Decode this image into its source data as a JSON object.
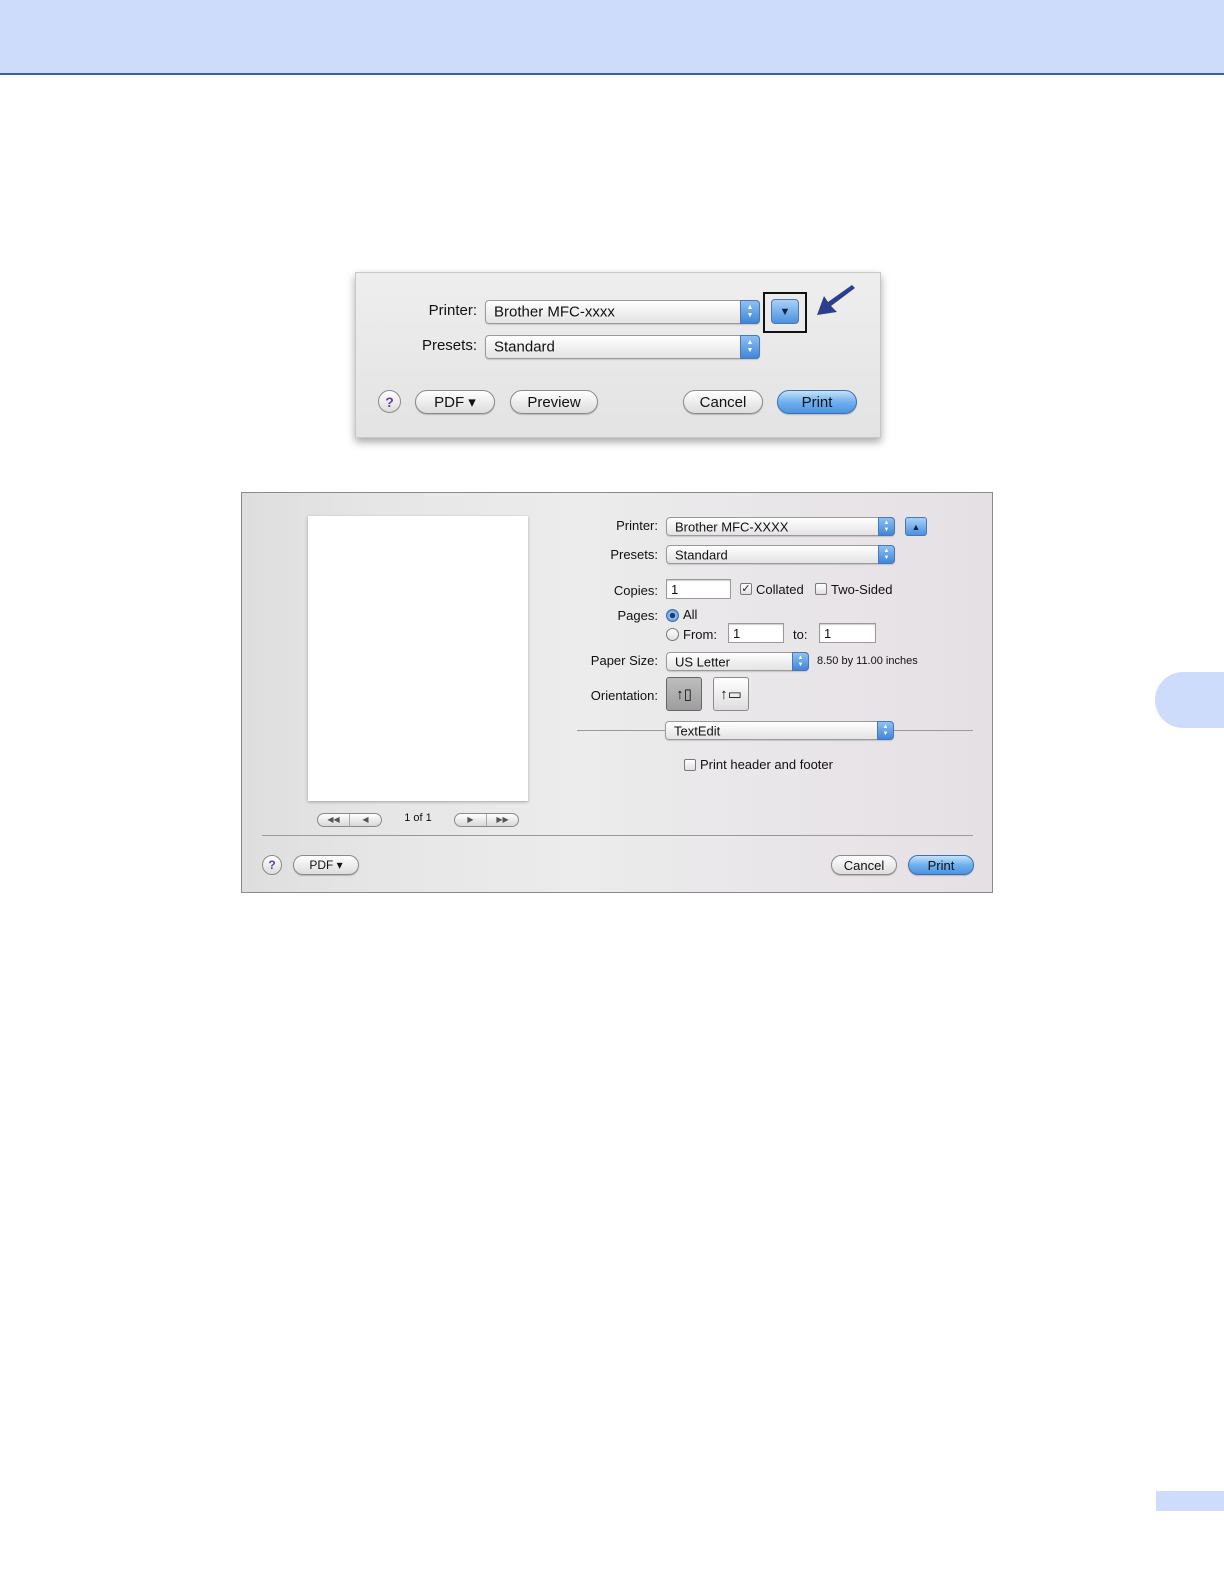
{
  "colors": {
    "accent_band": "#cddcfb",
    "band_rule": "#3b5fae",
    "arrow": "#2c3f8f",
    "aqua_button": "#4b93e2"
  },
  "dialog_compact": {
    "printer_label": "Printer:",
    "printer_value": "Brother MFC-xxxx",
    "presets_label": "Presets:",
    "presets_value": "Standard",
    "help_label": "?",
    "pdf_label": "PDF ▾",
    "preview_label": "Preview",
    "cancel_label": "Cancel",
    "print_label": "Print",
    "disclosure_icon": "▼",
    "annotation_icon": "arrow-pointer-icon"
  },
  "dialog_expanded": {
    "printer_label": "Printer:",
    "printer_value": "Brother MFC-XXXX",
    "disclosure_icon": "▲",
    "presets_label": "Presets:",
    "presets_value": "Standard",
    "copies_label": "Copies:",
    "copies_value": "1",
    "collated_label": "Collated",
    "collated_checked": true,
    "two_sided_label": "Two-Sided",
    "two_sided_checked": false,
    "pages_label": "Pages:",
    "pages_all_label": "All",
    "pages_from_label": "From:",
    "pages_from_value": "1",
    "pages_to_label": "to:",
    "pages_to_value": "1",
    "paper_size_label": "Paper Size:",
    "paper_size_value": "US Letter",
    "paper_size_dims": "8.50 by 11.00 inches",
    "orientation_label": "Orientation:",
    "portrait_icon": "portrait-orientation-icon",
    "landscape_icon": "landscape-orientation-icon",
    "app_panel_value": "TextEdit",
    "header_footer_label": "Print header and footer",
    "page_counter": "1 of 1",
    "help_label": "?",
    "pdf_label": "PDF ▾",
    "cancel_label": "Cancel",
    "print_label": "Print"
  }
}
